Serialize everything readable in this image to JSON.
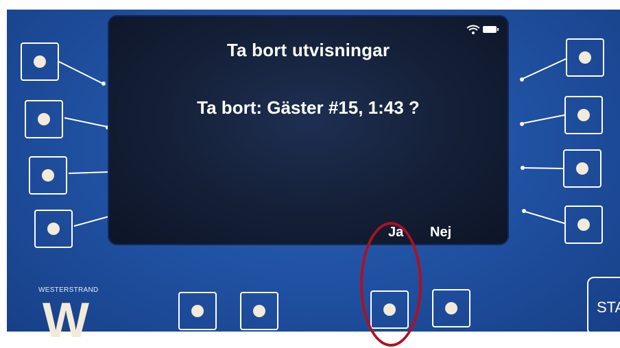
{
  "screen": {
    "title": "Ta bort utvisningar",
    "prompt": "Ta bort: Gäster #15, 1:43 ?",
    "softkeys": {
      "yes": "Ja",
      "no": "Nej"
    },
    "status_icons": [
      "wifi-icon",
      "battery-icon"
    ]
  },
  "brand": {
    "name": "WESTERSTRAND",
    "logo": "W"
  },
  "hardware": {
    "start_label": "STA"
  },
  "colors": {
    "panel": "#1f4f9f",
    "screen": "#141f36",
    "button_dot": "#f3ead9",
    "highlight": "#b01020"
  }
}
